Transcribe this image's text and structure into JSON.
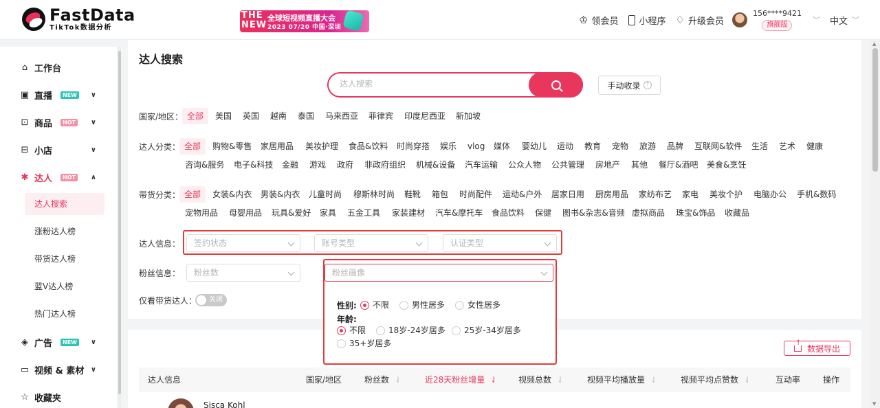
{
  "header": {
    "logo_name": "FastData",
    "logo_sub": "TikTok数据分析",
    "banner_new": "THE NEW",
    "banner_title": "全球短视频直播大会",
    "banner_date": "2023 07/20 中国·深圳",
    "vip": "领会员",
    "miniprogram": "小程序",
    "upgrade": "升级会员",
    "user_phone": "156****9421",
    "user_badge": "旗舰版",
    "language": "中文"
  },
  "sidebar": {
    "items": [
      {
        "label": "工作台",
        "icon": "home-icon"
      },
      {
        "label": "直播",
        "icon": "live-tv-icon",
        "tag": "NEW"
      },
      {
        "label": "商品",
        "icon": "product-box-icon",
        "tag": "HOT"
      },
      {
        "label": "小店",
        "icon": "shop-icon"
      },
      {
        "label": "达人",
        "icon": "star-person-icon",
        "tag": "HOT"
      },
      {
        "label": "广告",
        "icon": "ad-icon",
        "tag": "NEW"
      },
      {
        "label": "视频 & 素材",
        "icon": "video-icon"
      },
      {
        "label": "收藏夹",
        "icon": "favorite-star-icon"
      }
    ],
    "sub_items": [
      "达人搜索",
      "涨粉达人榜",
      "带货达人榜",
      "蓝V达人榜",
      "热门达人榜"
    ]
  },
  "main": {
    "title": "达人搜索",
    "search_placeholder": "达人搜索",
    "manual_button": "手动收录",
    "country_label": "国家/地区：",
    "countries": [
      "全部",
      "美国",
      "英国",
      "越南",
      "泰国",
      "马来西亚",
      "菲律宾",
      "印度尼西亚",
      "新加坡"
    ],
    "category_label": "达人分类：",
    "categories_row1": [
      "全部",
      "购物&零售",
      "家居用品",
      "美妆护理",
      "食品&饮料",
      "时尚穿搭",
      "娱乐",
      "vlog",
      "媒体",
      "婴幼儿",
      "运动",
      "教育",
      "宠物",
      "旅游",
      "品牌",
      "互联网&软件",
      "生活",
      "艺术",
      "健康"
    ],
    "categories_row2": [
      "咨询&服务",
      "电子&科技",
      "金融",
      "游戏",
      "政府",
      "非政府组织",
      "机械&设备",
      "汽车运输",
      "公众人物",
      "公共管理",
      "房地产",
      "其他",
      "餐厅&酒吧",
      "美食&烹饪"
    ],
    "goods_label": "带货分类：",
    "goods_row1": [
      "全部",
      "女装&内衣",
      "男装&内衣",
      "儿童时尚",
      "穆斯林时尚",
      "鞋靴",
      "箱包",
      "时尚配件",
      "运动&户外",
      "居家日用",
      "厨房用品",
      "家纺布艺",
      "家电",
      "美妆个护",
      "电脑办公",
      "手机&数码"
    ],
    "goods_row2": [
      "宠物用品",
      "母婴用品",
      "玩具&爱好",
      "家具",
      "五金工具",
      "家装建材",
      "汽车&摩托车",
      "食品饮料",
      "保健",
      "图书&杂志&音频",
      "虚拟商品",
      "珠宝&饰品",
      "收藏品"
    ],
    "info_label": "达人信息：",
    "info_selects": [
      "签约状态",
      "账号类型",
      "认证类型"
    ],
    "fans_label": "粉丝信息：",
    "fans_select": "粉丝数",
    "fans_portrait_select": "粉丝画像",
    "only_goods_label": "仅看带货达人：",
    "toggle_label": "关闭",
    "portrait": {
      "gender_label": "性别:",
      "gender_options": [
        "不限",
        "男性居多",
        "女性居多"
      ],
      "age_label": "年龄:",
      "age_options": [
        "不限",
        "18岁-24岁居多",
        "25岁-34岁居多",
        "35+岁居多"
      ]
    }
  },
  "table": {
    "export_button": "数据导出",
    "columns": [
      "达人信息",
      "国家/地区",
      "粉丝数",
      "近28天粉丝增量",
      "视频总数",
      "视频平均播放量",
      "视频平均点赞数",
      "互动率",
      "操作"
    ],
    "first_row_name": "Sisca Kohl"
  },
  "colors": {
    "accent": "#e8365c",
    "highlight_box": "#e33b3b"
  }
}
